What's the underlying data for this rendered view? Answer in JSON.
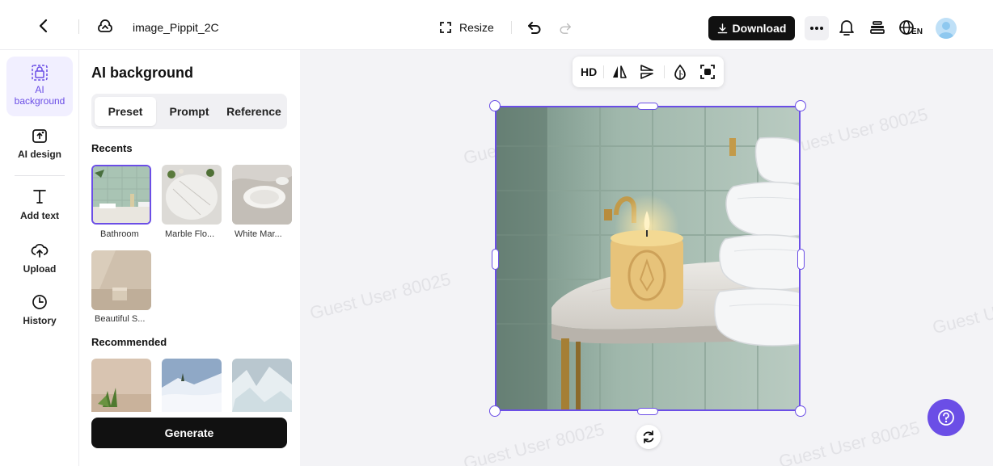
{
  "topbar": {
    "back_icon": "chevron-left-icon",
    "file_icon": "pippit-logo-icon",
    "file_name": "image_Pippit_2C",
    "resize_label": "Resize",
    "undo_icon": "undo-icon",
    "redo_icon": "redo-icon",
    "download_label": "Download",
    "download_icon": "download-icon",
    "more_icon": "more-dots-icon",
    "bell_icon": "bell-icon",
    "layers_icon": "stack-icon",
    "language_label": "EN",
    "avatar_icon": "avatar"
  },
  "leftnav": {
    "items": [
      {
        "label": "AI background",
        "icon": "ai-background-icon",
        "active": true
      },
      {
        "label": "AI design",
        "icon": "ai-design-icon"
      },
      {
        "label": "Add text",
        "icon": "text-icon"
      },
      {
        "label": "Upload",
        "icon": "upload-cloud-icon"
      },
      {
        "label": "History",
        "icon": "clock-icon"
      }
    ]
  },
  "panel": {
    "title": "AI background",
    "tabs": [
      {
        "label": "Preset",
        "active": true
      },
      {
        "label": "Prompt"
      },
      {
        "label": "Reference"
      }
    ],
    "recents_title": "Recents",
    "recents": [
      {
        "label": "Bathroom",
        "selected": true
      },
      {
        "label": "Marble Flo..."
      },
      {
        "label": "White Mar..."
      },
      {
        "label": "Beautiful S..."
      }
    ],
    "recommended_title": "Recommended",
    "generate_label": "Generate"
  },
  "canvas": {
    "toolbar": {
      "hd_label": "HD"
    },
    "watermark": "Guest User 80025",
    "help_icon": "help-icon"
  },
  "colors": {
    "accent": "#6b4ee6",
    "active_nav_bg": "#f1efff",
    "download_bg": "#111111",
    "canvas_bg": "#f3f3f6"
  }
}
